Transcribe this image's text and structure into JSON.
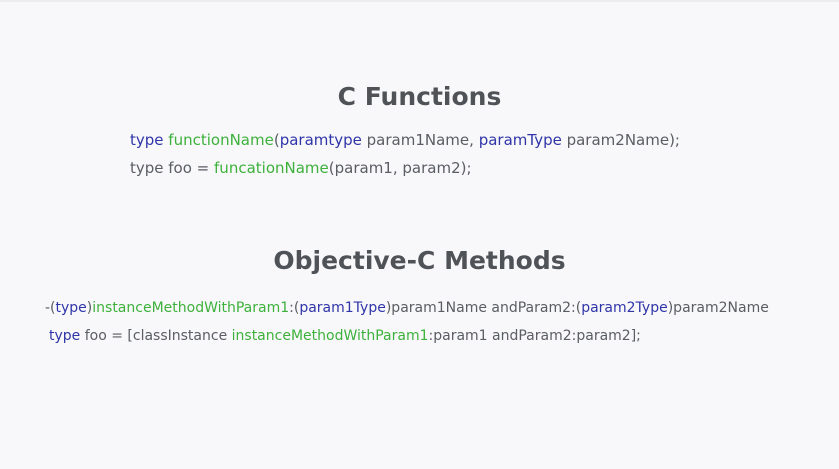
{
  "colors": {
    "background": "#f8f8fa",
    "heading": "#4f5257",
    "plain": "#5a5d63",
    "type": "#2f35a8",
    "func": "#3db13b"
  },
  "c_section": {
    "heading": "C Functions",
    "lines": [
      [
        {
          "text": "type",
          "style": "type"
        },
        {
          "text": " ",
          "style": "plain"
        },
        {
          "text": "functionName",
          "style": "func"
        },
        {
          "text": "(",
          "style": "plain"
        },
        {
          "text": "paramtype",
          "style": "type"
        },
        {
          "text": " param1Name, ",
          "style": "plain"
        },
        {
          "text": "paramType",
          "style": "type"
        },
        {
          "text": " param2Name);",
          "style": "plain"
        }
      ],
      [
        {
          "text": "type foo = ",
          "style": "plain"
        },
        {
          "text": "funcationName",
          "style": "func"
        },
        {
          "text": "(param1, param2);",
          "style": "plain"
        }
      ]
    ]
  },
  "objc_section": {
    "heading": "Objective-C Methods",
    "lines": [
      [
        {
          "text": "-(",
          "style": "plain"
        },
        {
          "text": "type",
          "style": "type"
        },
        {
          "text": ")",
          "style": "plain"
        },
        {
          "text": "instanceMethodWithParam1",
          "style": "func"
        },
        {
          "text": ":(",
          "style": "plain"
        },
        {
          "text": "param1Type",
          "style": "type"
        },
        {
          "text": ")param1Name andParam2:(",
          "style": "plain"
        },
        {
          "text": "param2Type",
          "style": "type"
        },
        {
          "text": ")param2Name",
          "style": "plain"
        }
      ],
      [
        {
          "text": "type",
          "style": "type"
        },
        {
          "text": " foo = [classInstance ",
          "style": "plain"
        },
        {
          "text": "instanceMethodWithParam1",
          "style": "func"
        },
        {
          "text": ":param1 andParam2:param2];",
          "style": "plain"
        }
      ]
    ]
  }
}
